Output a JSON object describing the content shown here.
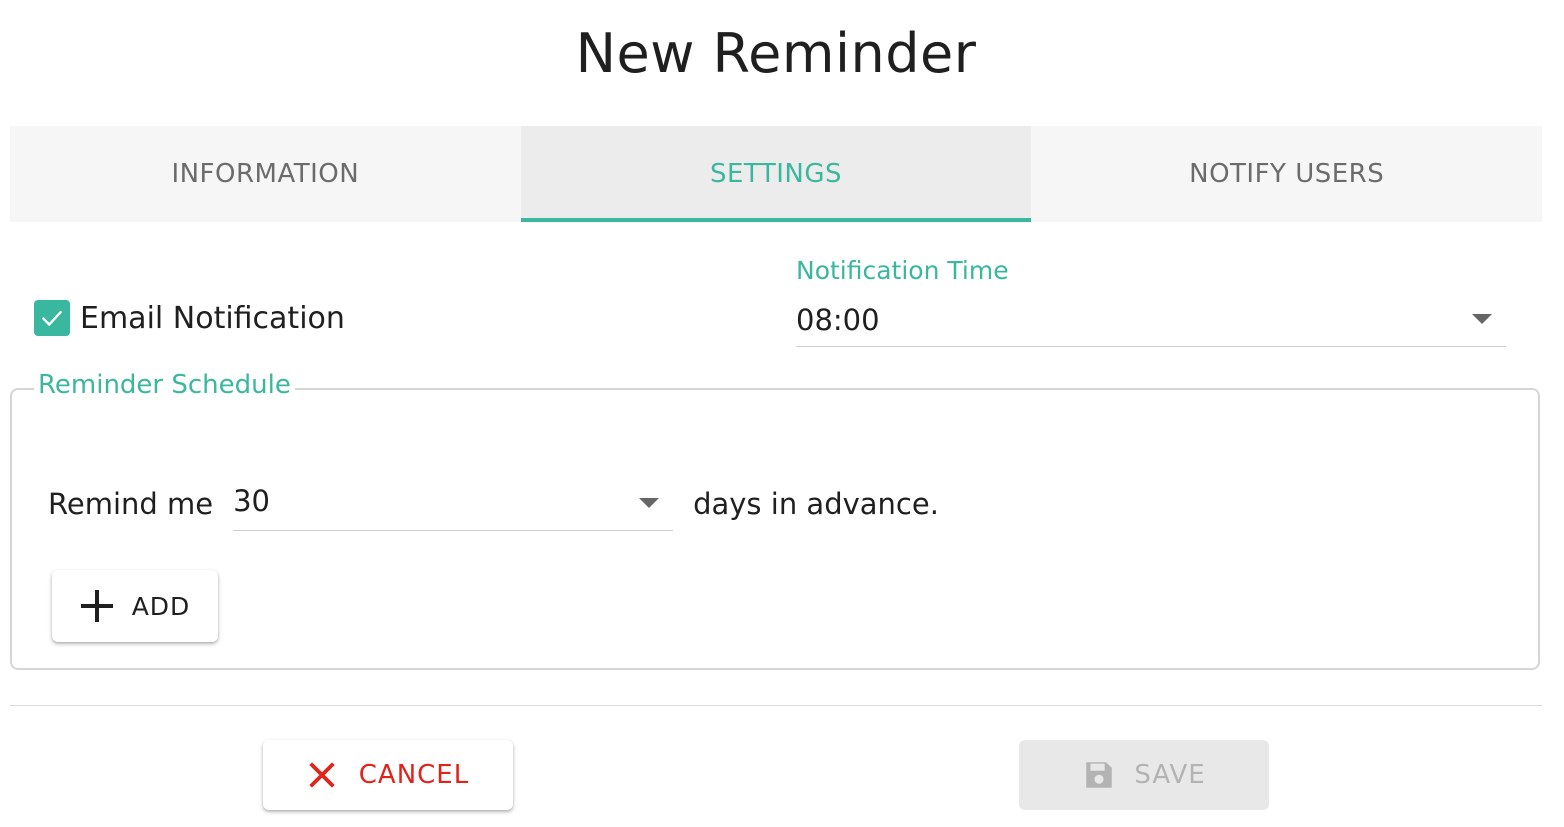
{
  "dialog": {
    "title": "New Reminder"
  },
  "tabs": [
    {
      "label": "INFORMATION",
      "active": false
    },
    {
      "label": "SETTINGS",
      "active": true
    },
    {
      "label": "NOTIFY USERS",
      "active": false
    }
  ],
  "settings": {
    "email_notification": {
      "label": "Email Notification",
      "checked": true
    },
    "notification_time": {
      "label": "Notification Time",
      "value": "08:00"
    }
  },
  "schedule": {
    "legend": "Reminder Schedule",
    "remind_prefix": "Remind me",
    "days_value": "30",
    "remind_suffix": "days in advance.",
    "add_label": "ADD"
  },
  "footer": {
    "cancel_label": "CANCEL",
    "save_label": "SAVE"
  },
  "colors": {
    "accent": "#3ab79f",
    "cancel": "#e2231a",
    "disabled": "#b3b3b3"
  },
  "icons": {
    "checkbox": "check-icon",
    "dropdown": "chevron-down-icon",
    "add": "plus-icon",
    "cancel": "close-icon",
    "save": "floppy-disk-icon"
  }
}
